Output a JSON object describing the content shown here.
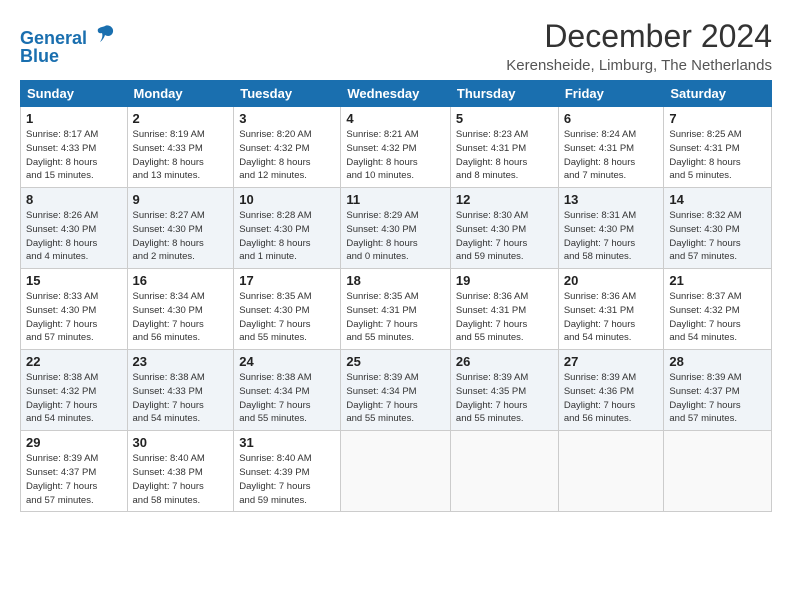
{
  "logo": {
    "line1": "General",
    "line2": "Blue"
  },
  "title": "December 2024",
  "subtitle": "Kerensheide, Limburg, The Netherlands",
  "weekdays": [
    "Sunday",
    "Monday",
    "Tuesday",
    "Wednesday",
    "Thursday",
    "Friday",
    "Saturday"
  ],
  "weeks": [
    [
      {
        "day": "1",
        "info": "Sunrise: 8:17 AM\nSunset: 4:33 PM\nDaylight: 8 hours\nand 15 minutes."
      },
      {
        "day": "2",
        "info": "Sunrise: 8:19 AM\nSunset: 4:33 PM\nDaylight: 8 hours\nand 13 minutes."
      },
      {
        "day": "3",
        "info": "Sunrise: 8:20 AM\nSunset: 4:32 PM\nDaylight: 8 hours\nand 12 minutes."
      },
      {
        "day": "4",
        "info": "Sunrise: 8:21 AM\nSunset: 4:32 PM\nDaylight: 8 hours\nand 10 minutes."
      },
      {
        "day": "5",
        "info": "Sunrise: 8:23 AM\nSunset: 4:31 PM\nDaylight: 8 hours\nand 8 minutes."
      },
      {
        "day": "6",
        "info": "Sunrise: 8:24 AM\nSunset: 4:31 PM\nDaylight: 8 hours\nand 7 minutes."
      },
      {
        "day": "7",
        "info": "Sunrise: 8:25 AM\nSunset: 4:31 PM\nDaylight: 8 hours\nand 5 minutes."
      }
    ],
    [
      {
        "day": "8",
        "info": "Sunrise: 8:26 AM\nSunset: 4:30 PM\nDaylight: 8 hours\nand 4 minutes."
      },
      {
        "day": "9",
        "info": "Sunrise: 8:27 AM\nSunset: 4:30 PM\nDaylight: 8 hours\nand 2 minutes."
      },
      {
        "day": "10",
        "info": "Sunrise: 8:28 AM\nSunset: 4:30 PM\nDaylight: 8 hours\nand 1 minute."
      },
      {
        "day": "11",
        "info": "Sunrise: 8:29 AM\nSunset: 4:30 PM\nDaylight: 8 hours\nand 0 minutes."
      },
      {
        "day": "12",
        "info": "Sunrise: 8:30 AM\nSunset: 4:30 PM\nDaylight: 7 hours\nand 59 minutes."
      },
      {
        "day": "13",
        "info": "Sunrise: 8:31 AM\nSunset: 4:30 PM\nDaylight: 7 hours\nand 58 minutes."
      },
      {
        "day": "14",
        "info": "Sunrise: 8:32 AM\nSunset: 4:30 PM\nDaylight: 7 hours\nand 57 minutes."
      }
    ],
    [
      {
        "day": "15",
        "info": "Sunrise: 8:33 AM\nSunset: 4:30 PM\nDaylight: 7 hours\nand 57 minutes."
      },
      {
        "day": "16",
        "info": "Sunrise: 8:34 AM\nSunset: 4:30 PM\nDaylight: 7 hours\nand 56 minutes."
      },
      {
        "day": "17",
        "info": "Sunrise: 8:35 AM\nSunset: 4:30 PM\nDaylight: 7 hours\nand 55 minutes."
      },
      {
        "day": "18",
        "info": "Sunrise: 8:35 AM\nSunset: 4:31 PM\nDaylight: 7 hours\nand 55 minutes."
      },
      {
        "day": "19",
        "info": "Sunrise: 8:36 AM\nSunset: 4:31 PM\nDaylight: 7 hours\nand 55 minutes."
      },
      {
        "day": "20",
        "info": "Sunrise: 8:36 AM\nSunset: 4:31 PM\nDaylight: 7 hours\nand 54 minutes."
      },
      {
        "day": "21",
        "info": "Sunrise: 8:37 AM\nSunset: 4:32 PM\nDaylight: 7 hours\nand 54 minutes."
      }
    ],
    [
      {
        "day": "22",
        "info": "Sunrise: 8:38 AM\nSunset: 4:32 PM\nDaylight: 7 hours\nand 54 minutes."
      },
      {
        "day": "23",
        "info": "Sunrise: 8:38 AM\nSunset: 4:33 PM\nDaylight: 7 hours\nand 54 minutes."
      },
      {
        "day": "24",
        "info": "Sunrise: 8:38 AM\nSunset: 4:34 PM\nDaylight: 7 hours\nand 55 minutes."
      },
      {
        "day": "25",
        "info": "Sunrise: 8:39 AM\nSunset: 4:34 PM\nDaylight: 7 hours\nand 55 minutes."
      },
      {
        "day": "26",
        "info": "Sunrise: 8:39 AM\nSunset: 4:35 PM\nDaylight: 7 hours\nand 55 minutes."
      },
      {
        "day": "27",
        "info": "Sunrise: 8:39 AM\nSunset: 4:36 PM\nDaylight: 7 hours\nand 56 minutes."
      },
      {
        "day": "28",
        "info": "Sunrise: 8:39 AM\nSunset: 4:37 PM\nDaylight: 7 hours\nand 57 minutes."
      }
    ],
    [
      {
        "day": "29",
        "info": "Sunrise: 8:39 AM\nSunset: 4:37 PM\nDaylight: 7 hours\nand 57 minutes."
      },
      {
        "day": "30",
        "info": "Sunrise: 8:40 AM\nSunset: 4:38 PM\nDaylight: 7 hours\nand 58 minutes."
      },
      {
        "day": "31",
        "info": "Sunrise: 8:40 AM\nSunset: 4:39 PM\nDaylight: 7 hours\nand 59 minutes."
      },
      {
        "day": "",
        "info": ""
      },
      {
        "day": "",
        "info": ""
      },
      {
        "day": "",
        "info": ""
      },
      {
        "day": "",
        "info": ""
      }
    ]
  ]
}
